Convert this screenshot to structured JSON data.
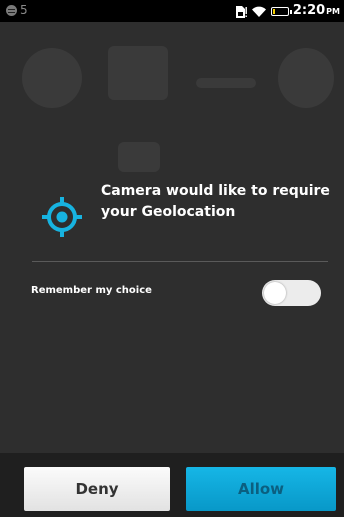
{
  "status_bar": {
    "notification_count": "5",
    "time": "2:20",
    "ampm": "PM",
    "icons": [
      "notification-icon",
      "sim-alert-icon",
      "wifi-icon",
      "battery-icon"
    ]
  },
  "dialog": {
    "message": "Camera would like to require your Geolocation",
    "icon": "geolocation-target-icon",
    "accent_color": "#17b3e0",
    "remember_label": "Remember my choice",
    "remember_checked": false
  },
  "buttons": {
    "deny": "Deny",
    "allow": "Allow"
  }
}
